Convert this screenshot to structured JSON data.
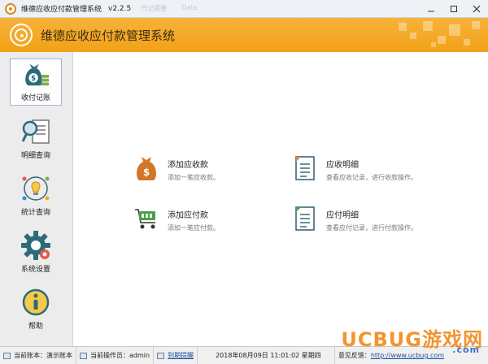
{
  "window": {
    "title": "维德应收应付款管理系统",
    "version": "v2.2.5",
    "background_tabs": [
      "代记需要",
      "Data"
    ]
  },
  "header": {
    "title": "维德应收应付款管理系统",
    "accent_color": "#f5a623"
  },
  "sidebar": {
    "items": [
      {
        "label": "收付记账",
        "icon": "money-bag-icon",
        "active": true
      },
      {
        "label": "明细查询",
        "icon": "magnifier-report-icon",
        "active": false
      },
      {
        "label": "统计查询",
        "icon": "lightbulb-chart-icon",
        "active": false
      },
      {
        "label": "系统设置",
        "icon": "gear-icon",
        "active": false
      },
      {
        "label": "帮助",
        "icon": "info-icon",
        "active": false
      }
    ]
  },
  "main": {
    "actions": [
      {
        "title": "添加应收款",
        "desc": "添加一笔应收款。",
        "icon": "money-bag-icon"
      },
      {
        "title": "应收明细",
        "desc": "查看应收记录，进行收款操作。",
        "icon": "document-list-icon"
      },
      {
        "title": "添加应付款",
        "desc": "添加一笔应付款。",
        "icon": "shopping-cart-icon"
      },
      {
        "title": "应付明细",
        "desc": "查看应付记录，进行付款操作。",
        "icon": "document-list-icon"
      }
    ]
  },
  "statusbar": {
    "account": "当前账本：演示账本",
    "operator": "当前操作员：admin",
    "due_reminder": "到期提醒",
    "datetime": "2018年08月09日 11:01:02 星期四",
    "feedback": "意见反馈：",
    "feedback_link": "http://www.ucbug.com"
  },
  "watermark": {
    "brand": "UCBUG游戏网",
    "domain": ".com"
  }
}
